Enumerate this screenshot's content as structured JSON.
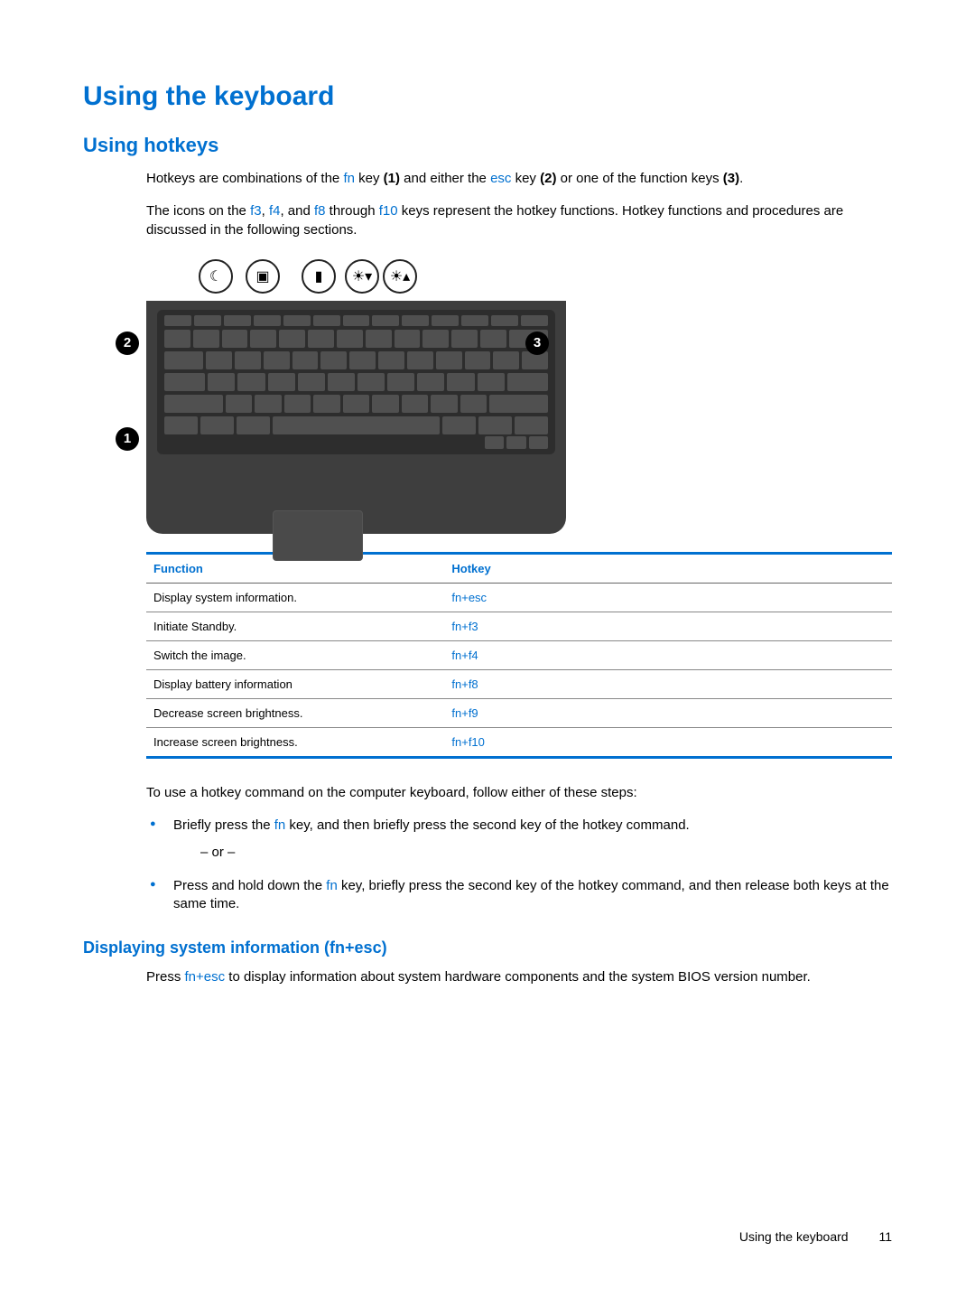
{
  "headings": {
    "h1": "Using the keyboard",
    "h2": "Using hotkeys",
    "h3": "Displaying system information (fn+esc)"
  },
  "para1": {
    "p1a": "Hotkeys are combinations of the ",
    "fn": "fn",
    "p1b": " key ",
    "b1": "(1)",
    "p1c": " and either the ",
    "esc": "esc",
    "p1d": " key ",
    "b2": "(2)",
    "p1e": " or one of the function keys ",
    "b3": "(3)",
    "p1f": "."
  },
  "para2": {
    "p2a": "The icons on the ",
    "f3": "f3",
    "c1": ", ",
    "f4": "f4",
    "c2": ", and ",
    "f8": "f8",
    "p2b": " through ",
    "f10": "f10",
    "p2c": " keys represent the hotkey functions. Hotkey functions and procedures are discussed in the following sections."
  },
  "callouts": {
    "b1": "1",
    "b2": "2",
    "b3": "3"
  },
  "icons": {
    "sleep": "☾",
    "display": "▣",
    "battery": "▮",
    "dim": "☀▾",
    "bright": "☀▴"
  },
  "table": {
    "headers": {
      "function": "Function",
      "hotkey": "Hotkey"
    },
    "rows": [
      {
        "function": "Display system information.",
        "hotkey": "fn+esc"
      },
      {
        "function": "Initiate Standby.",
        "hotkey": "fn+f3"
      },
      {
        "function": "Switch the image.",
        "hotkey": "fn+f4"
      },
      {
        "function": "Display battery information",
        "hotkey": "fn+f8"
      },
      {
        "function": "Decrease screen brightness.",
        "hotkey": "fn+f9"
      },
      {
        "function": "Increase screen brightness.",
        "hotkey": "fn+f10"
      }
    ]
  },
  "para3": "To use a hotkey command on the computer keyboard, follow either of these steps:",
  "bullet1": {
    "a": "Briefly press the ",
    "fn": "fn",
    "b": " key, and then briefly press the second key of the hotkey command."
  },
  "or": "– or –",
  "bullet2": {
    "a": "Press and hold down the ",
    "fn": "fn",
    "b": " key, briefly press the second key of the hotkey command, and then release both keys at the same time."
  },
  "para4": {
    "a": "Press ",
    "fnesc": "fn+esc",
    "b": " to display information about system hardware components and the system BIOS version number."
  },
  "footer": {
    "section": "Using the keyboard",
    "page": "11"
  }
}
